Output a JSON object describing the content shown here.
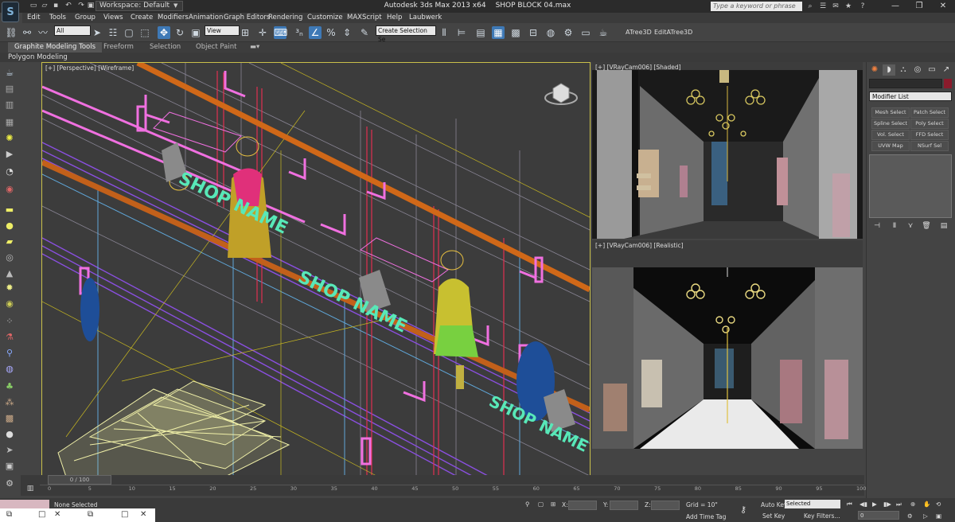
{
  "app": {
    "title": "Autodesk 3ds Max 2013 x64",
    "file": "SHOP BLOCK 04.max",
    "workspace": "Workspace: Default",
    "search_placeholder": "Type a keyword or phrase"
  },
  "menu": [
    "Edit",
    "Tools",
    "Group",
    "Views",
    "Create",
    "Modifiers",
    "Animation",
    "Graph Editors",
    "Rendering",
    "Customize",
    "MAXScript",
    "Help",
    "Laubwerk"
  ],
  "toolbar": {
    "filter": "All",
    "refcoord": "View",
    "selection_set": "Create Selection Se",
    "plugin1": "ATree3D",
    "plugin2": "EditATree3D"
  },
  "ribbon": {
    "tabs": [
      "Graphite Modeling Tools",
      "Freeform",
      "Selection",
      "Object Paint"
    ],
    "active": "Graphite Modeling Tools",
    "panel": "Polygon Modeling"
  },
  "viewports": {
    "left": {
      "label": "[+] [Perspective] [Wireframe]"
    },
    "right_top": {
      "label": "[+] [VRayCam006] [Shaded]"
    },
    "right_bottom": {
      "label": "[+] [VRayCam006] [Realistic]"
    }
  },
  "scene_text": {
    "sign": "SHOP NAME",
    "sign2": "SHOP NAME"
  },
  "command_panel": {
    "modifier_list": "Modifier List",
    "buttons": [
      "Mesh Select",
      "Patch Select",
      "Spline Select",
      "Poly Select",
      "Vol. Select",
      "FFD Select",
      "UVW Map",
      "NSurf Sel"
    ]
  },
  "timeline": {
    "slider": "0 / 100",
    "ticks": [
      "0",
      "5",
      "10",
      "15",
      "20",
      "25",
      "30",
      "35",
      "40",
      "45",
      "50",
      "55",
      "60",
      "65",
      "70",
      "75",
      "80",
      "85",
      "90",
      "95",
      "100"
    ]
  },
  "status": {
    "selection": "None Selected",
    "x_label": "X:",
    "y_label": "Y:",
    "z_label": "Z:",
    "grid": "Grid = 10\"",
    "add_time_tag": "Add Time Tag",
    "auto_key": "Auto Key",
    "set_key": "Set Key",
    "selected": "Selected",
    "key_filters": "Key Filters...",
    "frame": "0"
  }
}
